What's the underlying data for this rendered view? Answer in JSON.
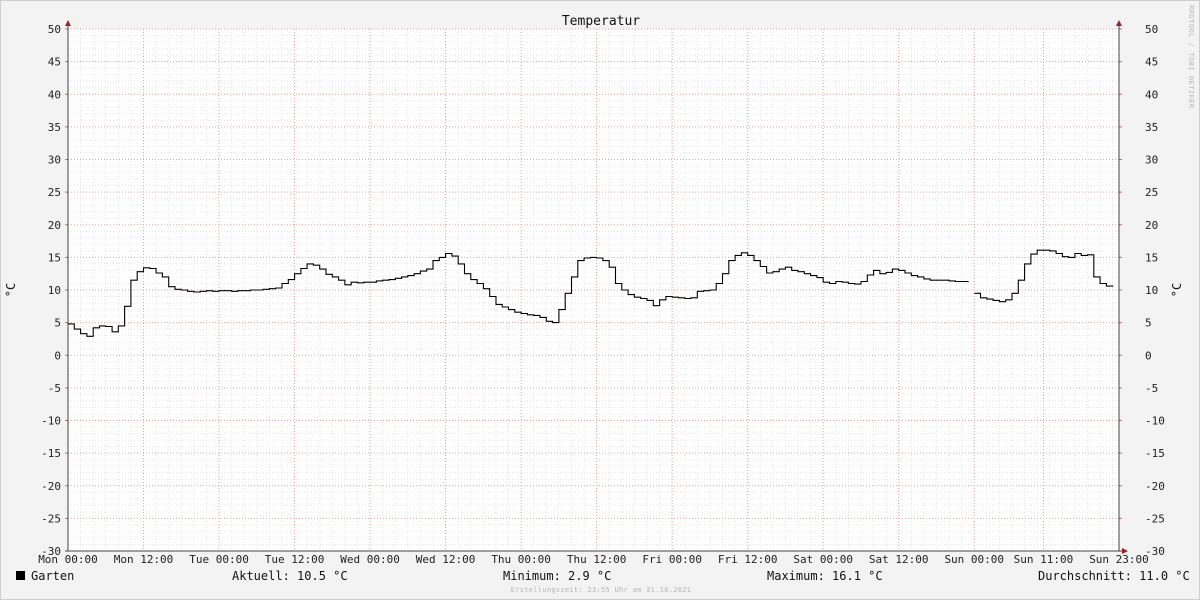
{
  "chart_data": {
    "type": "line",
    "title": "Temperatur",
    "ylabel": "°C",
    "ylabel_right": "°C",
    "ylim": [
      -30,
      50
    ],
    "y_ticks": [
      50,
      45,
      40,
      35,
      30,
      25,
      20,
      15,
      10,
      5,
      0,
      -5,
      -10,
      -15,
      -20,
      -25,
      -30
    ],
    "x_start": "Mon 00:00",
    "x_end": "Sun 23:00",
    "x_ticks": [
      {
        "h": 0,
        "label": "Mon 00:00"
      },
      {
        "h": 12,
        "label": "Mon 12:00"
      },
      {
        "h": 24,
        "label": "Tue 00:00"
      },
      {
        "h": 36,
        "label": "Tue 12:00"
      },
      {
        "h": 48,
        "label": "Wed 00:00"
      },
      {
        "h": 60,
        "label": "Wed 12:00"
      },
      {
        "h": 72,
        "label": "Thu 00:00"
      },
      {
        "h": 84,
        "label": "Thu 12:00"
      },
      {
        "h": 96,
        "label": "Fri 00:00"
      },
      {
        "h": 108,
        "label": "Fri 12:00"
      },
      {
        "h": 120,
        "label": "Sat 00:00"
      },
      {
        "h": 132,
        "label": "Sat 12:00"
      },
      {
        "h": 144,
        "label": "Sun 00:00"
      },
      {
        "h": 155,
        "label": "Sun 11:00"
      },
      {
        "h": 167,
        "label": "Sun 23:00"
      }
    ],
    "grid": true,
    "series": [
      {
        "name": "Garten",
        "color": "#000000",
        "points": [
          [
            0,
            4.8
          ],
          [
            1,
            4.0
          ],
          [
            2,
            3.3
          ],
          [
            3,
            2.9
          ],
          [
            4,
            4.2
          ],
          [
            5,
            4.5
          ],
          [
            6,
            4.4
          ],
          [
            7,
            3.6
          ],
          [
            8,
            4.5
          ],
          [
            9,
            7.5
          ],
          [
            10,
            11.5
          ],
          [
            11,
            12.8
          ],
          [
            12,
            13.4
          ],
          [
            13,
            13.3
          ],
          [
            14,
            12.6
          ],
          [
            15,
            12.0
          ],
          [
            16,
            10.5
          ],
          [
            17,
            10.1
          ],
          [
            18,
            10.0
          ],
          [
            19,
            9.8
          ],
          [
            20,
            9.7
          ],
          [
            21,
            9.8
          ],
          [
            22,
            9.9
          ],
          [
            23,
            9.8
          ],
          [
            24,
            9.9
          ],
          [
            25,
            9.9
          ],
          [
            26,
            9.8
          ],
          [
            27,
            9.9
          ],
          [
            28,
            9.9
          ],
          [
            29,
            10.0
          ],
          [
            30,
            10.0
          ],
          [
            31,
            10.1
          ],
          [
            32,
            10.2
          ],
          [
            33,
            10.3
          ],
          [
            34,
            11.0
          ],
          [
            35,
            11.6
          ],
          [
            36,
            12.5
          ],
          [
            37,
            13.3
          ],
          [
            38,
            14.0
          ],
          [
            39,
            13.8
          ],
          [
            40,
            13.2
          ],
          [
            41,
            12.4
          ],
          [
            42,
            12.0
          ],
          [
            43,
            11.5
          ],
          [
            44,
            10.8
          ],
          [
            45,
            11.2
          ],
          [
            46,
            11.1
          ],
          [
            47,
            11.2
          ],
          [
            48,
            11.2
          ],
          [
            49,
            11.4
          ],
          [
            50,
            11.5
          ],
          [
            51,
            11.6
          ],
          [
            52,
            11.8
          ],
          [
            53,
            12.0
          ],
          [
            54,
            12.2
          ],
          [
            55,
            12.5
          ],
          [
            56,
            12.9
          ],
          [
            57,
            13.2
          ],
          [
            58,
            14.5
          ],
          [
            59,
            15.0
          ],
          [
            60,
            15.6
          ],
          [
            61,
            15.2
          ],
          [
            62,
            14.0
          ],
          [
            63,
            12.5
          ],
          [
            64,
            11.6
          ],
          [
            65,
            11.0
          ],
          [
            66,
            10.2
          ],
          [
            67,
            9.0
          ],
          [
            68,
            7.8
          ],
          [
            69,
            7.4
          ],
          [
            70,
            7.0
          ],
          [
            71,
            6.6
          ],
          [
            72,
            6.4
          ],
          [
            73,
            6.2
          ],
          [
            74,
            6.1
          ],
          [
            75,
            5.8
          ],
          [
            76,
            5.2
          ],
          [
            77,
            5.0
          ],
          [
            78,
            7.0
          ],
          [
            79,
            9.5
          ],
          [
            80,
            12.0
          ],
          [
            81,
            14.5
          ],
          [
            82,
            14.9
          ],
          [
            83,
            15.0
          ],
          [
            84,
            14.9
          ],
          [
            85,
            14.5
          ],
          [
            86,
            13.5
          ],
          [
            87,
            11.0
          ],
          [
            88,
            10.0
          ],
          [
            89,
            9.3
          ],
          [
            90,
            8.9
          ],
          [
            91,
            8.7
          ],
          [
            92,
            8.4
          ],
          [
            93,
            7.6
          ],
          [
            94,
            8.5
          ],
          [
            95,
            9.0
          ],
          [
            96,
            8.9
          ],
          [
            97,
            8.8
          ],
          [
            98,
            8.7
          ],
          [
            99,
            8.8
          ],
          [
            100,
            9.8
          ],
          [
            101,
            9.9
          ],
          [
            102,
            10.0
          ],
          [
            103,
            11.0
          ],
          [
            104,
            12.5
          ],
          [
            105,
            14.5
          ],
          [
            106,
            15.3
          ],
          [
            107,
            15.7
          ],
          [
            108,
            15.3
          ],
          [
            109,
            14.5
          ],
          [
            110,
            13.6
          ],
          [
            111,
            12.6
          ],
          [
            112,
            12.8
          ],
          [
            113,
            13.2
          ],
          [
            114,
            13.5
          ],
          [
            115,
            13.0
          ],
          [
            116,
            12.8
          ],
          [
            117,
            12.5
          ],
          [
            118,
            12.2
          ],
          [
            119,
            11.9
          ],
          [
            120,
            11.2
          ],
          [
            121,
            11.0
          ],
          [
            122,
            11.3
          ],
          [
            123,
            11.2
          ],
          [
            124,
            11.0
          ],
          [
            125,
            10.9
          ],
          [
            126,
            11.3
          ],
          [
            127,
            12.3
          ],
          [
            128,
            13.0
          ],
          [
            129,
            12.5
          ],
          [
            130,
            12.7
          ],
          [
            131,
            13.2
          ],
          [
            132,
            13.0
          ],
          [
            133,
            12.6
          ],
          [
            134,
            12.2
          ],
          [
            135,
            12.0
          ],
          [
            136,
            11.7
          ],
          [
            137,
            11.5
          ],
          [
            138,
            11.5
          ],
          [
            139,
            11.5
          ],
          [
            140,
            11.4
          ],
          [
            141,
            11.3
          ],
          [
            142,
            11.3
          ],
          [
            143,
            11.2
          ],
          null,
          [
            144,
            9.5
          ],
          [
            145,
            8.8
          ],
          [
            146,
            8.6
          ],
          [
            147,
            8.4
          ],
          [
            148,
            8.2
          ],
          [
            149,
            8.5
          ],
          [
            150,
            9.5
          ],
          [
            151,
            11.5
          ],
          [
            152,
            14.0
          ],
          [
            153,
            15.5
          ],
          [
            154,
            16.1
          ],
          [
            155,
            16.1
          ],
          [
            156,
            16.0
          ],
          [
            157,
            15.6
          ],
          [
            158,
            15.1
          ],
          [
            159,
            15.0
          ],
          [
            160,
            15.6
          ],
          [
            161,
            15.3
          ],
          [
            162,
            15.4
          ],
          [
            163,
            12.0
          ],
          [
            164,
            11.0
          ],
          [
            165,
            10.6
          ],
          [
            166,
            10.5
          ]
        ]
      }
    ]
  },
  "watermark": "RRDTOOL / TOBI OETIKER",
  "legend": {
    "series_name": "Garten",
    "swatch_color": "#000000",
    "current": "Aktuell: 10.5 °C",
    "minimum": "Minimum: 2.9 °C",
    "maximum": "Maximum: 16.1 °C",
    "average": "Durchschnitt: 11.0 °C"
  },
  "footer": "Erstellungszeit: 23:55 Uhr am 31.10.2021"
}
